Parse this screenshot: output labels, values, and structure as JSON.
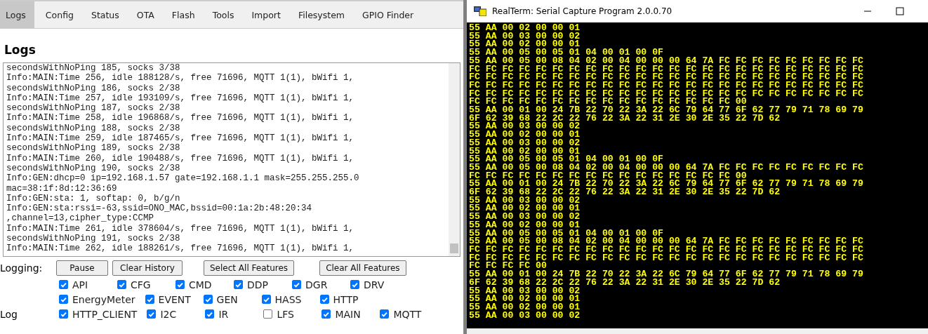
{
  "web_panel": {
    "tabs": [
      {
        "label": "Logs",
        "selected": true
      },
      {
        "label": "Config",
        "selected": false
      },
      {
        "label": "Status",
        "selected": false
      },
      {
        "label": "OTA",
        "selected": false
      },
      {
        "label": "Flash",
        "selected": false
      },
      {
        "label": "Tools",
        "selected": false
      },
      {
        "label": "Import",
        "selected": false
      },
      {
        "label": "Filesystem",
        "selected": false
      },
      {
        "label": "GPIO Finder",
        "selected": false
      }
    ],
    "heading": "Logs",
    "log_lines": [
      "secondsWithNoPing 185, socks 3/38",
      "Info:MAIN:Time 256, idle 188128/s, free 71696, MQTT 1(1), bWifi 1,",
      "secondsWithNoPing 186, socks 2/38",
      "Info:MAIN:Time 257, idle 193109/s, free 71696, MQTT 1(1), bWifi 1,",
      "secondsWithNoPing 187, socks 2/38",
      "Info:MAIN:Time 258, idle 196868/s, free 71696, MQTT 1(1), bWifi 1,",
      "secondsWithNoPing 188, socks 2/38",
      "Info:MAIN:Time 259, idle 187465/s, free 71696, MQTT 1(1), bWifi 1,",
      "secondsWithNoPing 189, socks 2/38",
      "Info:MAIN:Time 260, idle 190488/s, free 71696, MQTT 1(1), bWifi 1,",
      "secondsWithNoPing 190, socks 2/38",
      "Info:GEN:dhcp=0 ip=192.168.1.57 gate=192.168.1.1 mask=255.255.255.0",
      "mac=38:1f:8d:12:36:69",
      "Info:GEN:sta: 1, softap: 0, b/g/n",
      "Info:GEN:sta:rssi=-63,ssid=ONO_MAC,bssid=00:1a:2b:48:20:34",
      ",channel=13,cipher_type:CCMP",
      "Info:MAIN:Time 261, idle 378604/s, free 71696, MQTT 1(1), bWifi 1,",
      "secondsWithNoPing 191, socks 2/38",
      "Info:MAIN:Time 262, idle 188261/s, free 71696, MQTT 1(1), bWifi 1,"
    ],
    "logging_label": "Logging:",
    "buttons": [
      "Pause",
      "Clear History",
      "Select All Features",
      "Clear All Features"
    ],
    "log_label": "Log",
    "feature_rows": [
      [
        {
          "label": "API",
          "checked": true
        },
        {
          "label": "CFG",
          "checked": true
        },
        {
          "label": "CMD",
          "checked": true
        },
        {
          "label": "DDP",
          "checked": true
        },
        {
          "label": "DGR",
          "checked": true
        },
        {
          "label": "DRV",
          "checked": true
        }
      ],
      [
        {
          "label": "EnergyMeter",
          "checked": true
        },
        {
          "label": "EVENT",
          "checked": true
        },
        {
          "label": "GEN",
          "checked": true
        },
        {
          "label": "HASS",
          "checked": true
        },
        {
          "label": "HTTP",
          "checked": true
        }
      ],
      [
        {
          "label": "HTTP_CLIENT",
          "checked": true
        },
        {
          "label": "I2C",
          "checked": true
        },
        {
          "label": "IR",
          "checked": true
        },
        {
          "label": "LFS",
          "checked": false
        },
        {
          "label": "MAIN",
          "checked": true
        },
        {
          "label": "MQTT",
          "checked": true
        }
      ]
    ]
  },
  "terminal_window": {
    "title": "RealTerm: Serial Capture Program 2.0.0.70",
    "lines": [
      "55 AA 00 02 00 00 01",
      "55 AA 00 03 00 00 02",
      "55 AA 00 02 00 00 01",
      "55 AA 00 05 00 05 01 04 00 01 00 0F",
      "55 AA 00 05 00 08 04 02 00 04 00 00 00 64 7A FC FC FC FC FC FC FC FC FC",
      "FC FC FC FC FC FC FC FC FC FC FC FC FC FC FC FC FC FC FC FC FC FC FC FC",
      "FC FC FC FC FC FC FC FC FC FC FC FC FC FC FC FC FC FC FC FC FC FC FC FC",
      "FC FC FC FC FC FC FC FC FC FC FC FC FC FC FC FC FC FC FC FC FC FC FC FC",
      "FC FC FC FC FC FC FC FC FC FC FC FC FC FC FC FC FC FC FC FC FC FC FC FC",
      "FC FC FC FC FC FC FC FC FC FC FC FC FC FC FC FC 00",
      "55 AA 00 01 00 24 7B 22 70 22 3A 22 6C 79 64 77 6F 62 77 79 71 78 69 79",
      "6F 62 39 68 22 2C 22 76 22 3A 22 31 2E 30 2E 35 22 7D 62",
      "55 AA 00 03 00 00 02",
      "55 AA 00 02 00 00 01",
      "55 AA 00 03 00 00 02",
      "55 AA 00 02 00 00 01",
      "55 AA 00 05 00 05 01 04 00 01 00 0F",
      "55 AA 00 05 00 08 04 02 00 04 00 00 00 64 7A FC FC FC FC FC FC FC FC FC",
      "FC FC FC FC FC FC FC FC FC FC FC FC FC FC FC FC 00",
      "55 AA 00 01 00 24 7B 22 70 22 3A 22 6C 79 64 77 6F 62 77 79 71 78 69 79",
      "6F 62 39 68 22 2C 22 76 22 3A 22 31 2E 30 2E 35 22 7D 62",
      "55 AA 00 03 00 00 02",
      "55 AA 00 02 00 00 01",
      "55 AA 00 03 00 00 02",
      "55 AA 00 02 00 00 01",
      "55 AA 00 05 00 05 01 04 00 01 00 0F",
      "55 AA 00 05 00 08 04 02 00 04 00 00 00 64 7A FC FC FC FC FC FC FC FC FC",
      "FC FC FC FC FC FC FC FC FC FC FC FC FC FC FC FC FC FC FC FC FC FC FC FC",
      "FC FC FC FC FC FC FC FC FC FC FC FC FC FC FC FC FC FC FC FC FC FC FC FC",
      "FC FC FC FC 00",
      "55 AA 00 01 00 24 7B 22 70 22 3A 22 6C 79 64 77 6F 62 77 79 71 78 69 79",
      "6F 62 39 68 22 2C 22 76 22 3A 22 31 2E 30 2E 35 22 7D 62",
      "55 AA 00 03 00 00 02",
      "55 AA 00 02 00 00 01",
      "55 AA 00 02 00 00 01",
      "55 AA 00 03 00 00 02"
    ]
  }
}
